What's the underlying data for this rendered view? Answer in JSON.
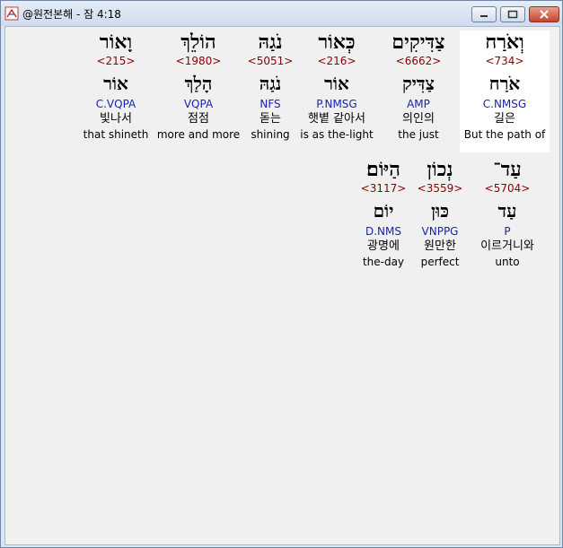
{
  "window": {
    "title": "@원전본해 - 잠 4:18",
    "controls": {
      "minimize": "minimize",
      "maximize": "maximize",
      "close": "close"
    }
  },
  "words": [
    {
      "hebrew": "וְאֹרַח",
      "strong": "<734>",
      "lemma": "אֹרַח",
      "morph": "C.NMSG",
      "korean": "길은",
      "english": "But the path of"
    },
    {
      "hebrew": "צַדִּיקִים",
      "strong": "<6662>",
      "lemma": "צַדִּיק",
      "morph": "AMP",
      "korean": "의인의",
      "english": "the just"
    },
    {
      "hebrew": "כְּאוֹר",
      "strong": "<216>",
      "lemma": "אוֹר",
      "morph": "P.NMSG",
      "korean": "햇볕 같아서",
      "english": "is as the-light"
    },
    {
      "hebrew": "נֹגַהּ",
      "strong": "<5051>",
      "lemma": "נֹגַהּ",
      "morph": "NFS",
      "korean": "돋는",
      "english": "shining"
    },
    {
      "hebrew": "הוֹלֵךְ",
      "strong": "<1980>",
      "lemma": "הָלַךְ",
      "morph": "VQPA",
      "korean": "점점",
      "english": "more and more"
    },
    {
      "hebrew": "וָאוֹר",
      "strong": "<215>",
      "lemma": "אוֹר",
      "morph": "C.VQPA",
      "korean": "빛나서",
      "english": "that shineth"
    },
    {
      "hebrew": "עַד־",
      "strong": "<5704>",
      "lemma": "עַד",
      "morph": "P",
      "korean": "이르거니와",
      "english": "unto"
    },
    {
      "hebrew": "נְכוֹן",
      "strong": "<3559>",
      "lemma": "כּוּן",
      "morph": "VNPPG",
      "korean": "원만한",
      "english": "perfect"
    },
    {
      "hebrew": "הַיּוֹם׃",
      "strong": "<3117>",
      "lemma": "יוֹם",
      "morph": "D.NMS",
      "korean": "광명에",
      "english": "the-day"
    }
  ]
}
